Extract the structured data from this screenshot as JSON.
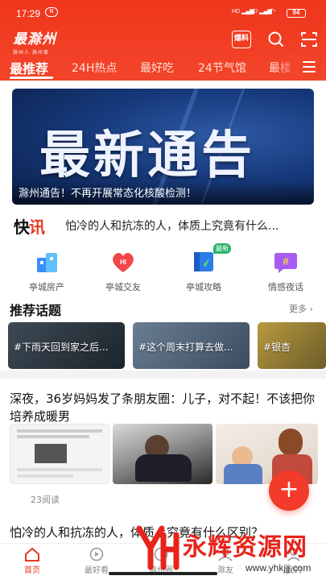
{
  "status_bar": {
    "time": "17:29",
    "nfc": "N",
    "signal1": "HD",
    "signal2": "HD",
    "battery": "94"
  },
  "header": {
    "logo_main": "最滁州",
    "logo_sub": "滁州人 滁州事",
    "baoliao_label": "爆料"
  },
  "tabs": [
    {
      "label": "最推荐",
      "active": true
    },
    {
      "label": "24H热点"
    },
    {
      "label": "最好吃"
    },
    {
      "label": "24节气馆"
    },
    {
      "label": "最楼"
    }
  ],
  "banner": {
    "headline": "最新通告",
    "caption": "滁州通告！不再开展常态化核酸检测！"
  },
  "kuaixun": {
    "brand_a": "快",
    "brand_b": "讯",
    "text": "怕冷的人和抗冻的人，体质上究竟有什么..."
  },
  "quick_links": [
    {
      "label": "亭城房产",
      "icon": "house-icon"
    },
    {
      "label": "亭城交友",
      "icon": "heart-icon"
    },
    {
      "label": "亭城攻略",
      "icon": "guide-icon",
      "badge": "最新"
    },
    {
      "label": "情感夜话",
      "icon": "hash-bubble-icon"
    }
  ],
  "topics_section": {
    "title": "推荐话题",
    "more": "更多",
    "items": [
      {
        "label": "#下雨天回到家之后..."
      },
      {
        "label": "#这个周末打算去做..."
      },
      {
        "label": "#银杏"
      }
    ]
  },
  "feed_item": {
    "title": "深夜，36岁妈妈发了条朋友圈：儿子，对不起！不该把你培养成暖男",
    "reads": "23阅读",
    "close": "×"
  },
  "feed_item_2": {
    "title": "怕冷的人和抗冻的人，体质上究竟有什么区别？"
  },
  "fab_label": "+",
  "bottom_nav": [
    {
      "label": "首页",
      "active": true
    },
    {
      "label": "最好看"
    },
    {
      "label": "滁州圈"
    },
    {
      "label": "滁友"
    },
    {
      "label": "我的"
    }
  ],
  "watermark": {
    "text": "永辉资源网",
    "url": "www.yhkjjj.com"
  },
  "colors": {
    "brand_red": "#f0361c",
    "accent_green": "#2fb36b"
  }
}
